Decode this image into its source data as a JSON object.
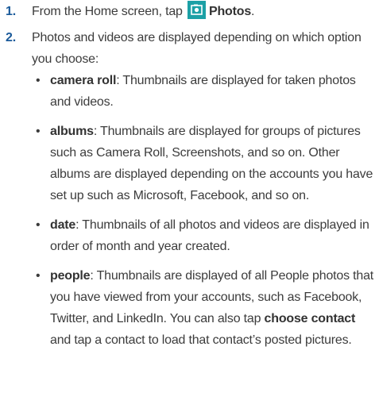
{
  "steps": [
    {
      "number": "1.",
      "text_before": "From the Home screen, tap",
      "app_name": "Photos",
      "text_after": "."
    },
    {
      "number": "2.",
      "text": "Photos and videos are displayed depending on which option you choose:"
    }
  ],
  "options": [
    {
      "term": "camera roll",
      "description": ": Thumbnails are displayed for taken photos and videos."
    },
    {
      "term": "albums",
      "description": ": Thumbnails are displayed for groups of pictures such as Camera Roll, Screenshots, and so on. Other albums are displayed depending on the accounts you have set up such as Microsoft, Facebook, and so on."
    },
    {
      "term": "date",
      "description": ": Thumbnails of all photos and videos are displayed in order of month and year created."
    },
    {
      "term": "people",
      "description": ": Thumbnails are displayed of all People photos that you have viewed from your accounts, such as Facebook, Twitter, and LinkedIn. You can also tap",
      "term2": "choose contact",
      "description2": "and tap a contact to load that contact’s posted pictures."
    }
  ],
  "bullet_symbol": "•",
  "colors": {
    "step_number": "#1a5a9a",
    "photos_icon_bg": "#1ca0a6"
  },
  "icons": {
    "photos_app": "photos-icon"
  }
}
